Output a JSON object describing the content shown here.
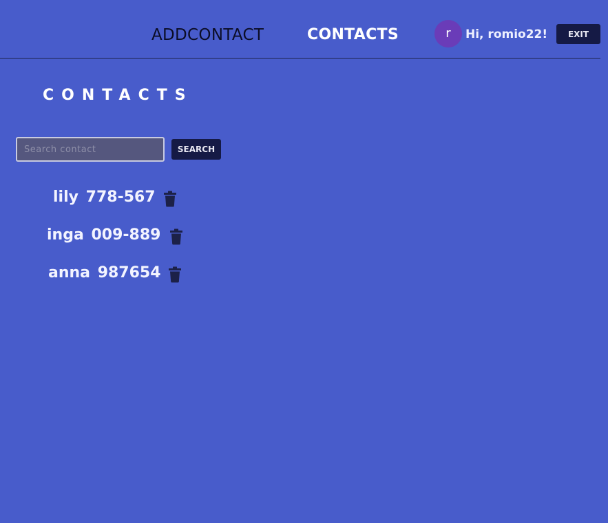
{
  "header": {
    "nav_add_contact": "ADDCONTACT",
    "nav_contacts": "CONTACTS",
    "avatar_letter": "r",
    "greeting": "Hi, romio22!",
    "exit_label": "EXIT"
  },
  "main": {
    "title": "CONTACTS",
    "search": {
      "placeholder": "Search contact",
      "value": "",
      "button_label": "SEARCH"
    },
    "contacts": [
      {
        "name": "lily",
        "number": "778-567",
        "delete_icon": "trash-icon"
      },
      {
        "name": "inga",
        "number": "009-889",
        "delete_icon": "trash-icon"
      },
      {
        "name": "anna",
        "number": "987654",
        "delete_icon": "trash-icon"
      }
    ]
  },
  "colors": {
    "background": "#485ccb",
    "dark_button": "#151a45",
    "avatar": "#6a3cb8",
    "trash_icon": "#1c2148"
  }
}
